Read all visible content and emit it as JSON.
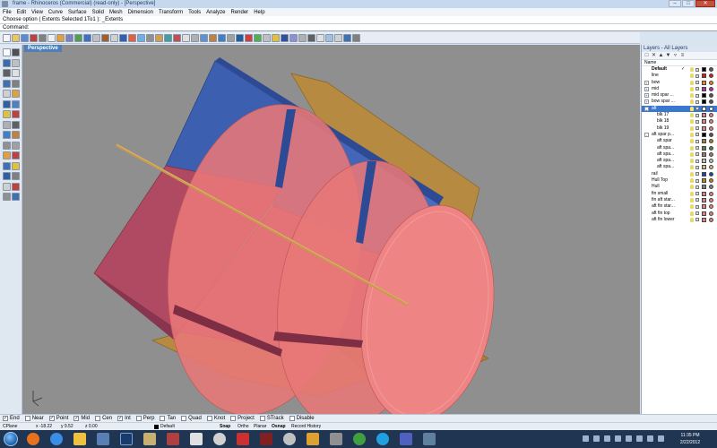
{
  "window": {
    "title": "frame - Rhinoceros (Commercial) (read-only) - [Perspective]"
  },
  "menu": [
    "File",
    "Edit",
    "View",
    "Curve",
    "Surface",
    "Solid",
    "Mesh",
    "Dimension",
    "Transform",
    "Tools",
    "Analyze",
    "Render",
    "Help"
  ],
  "command": {
    "history": "Choose option ( Extents  Selected  1To1 ): _Extents",
    "prompt": "Command:"
  },
  "viewport": {
    "name": "Perspective"
  },
  "layers_panel": {
    "title": "Layers - All Layers",
    "header": "Name",
    "layers": [
      {
        "name": "Default",
        "check": "✓",
        "indent": 0,
        "expand": "",
        "color": "#000000",
        "bold": true
      },
      {
        "name": "line",
        "indent": 0,
        "expand": "",
        "color": "#cc2222"
      },
      {
        "name": "bow",
        "indent": 0,
        "expand": "+",
        "color": "#e08a1e"
      },
      {
        "name": "mid",
        "indent": 0,
        "expand": "+",
        "color": "#b030b0"
      },
      {
        "name": "mid spar ...",
        "indent": 0,
        "expand": "+",
        "color": "#000000"
      },
      {
        "name": "bow spar ...",
        "indent": 0,
        "expand": "+",
        "color": "#000000"
      },
      {
        "name": "aft",
        "indent": 0,
        "expand": "-",
        "color": "#ffffff",
        "selected": true
      },
      {
        "name": "blk 17",
        "indent": 1,
        "expand": "",
        "color": "#e08080"
      },
      {
        "name": "blk 18",
        "indent": 1,
        "expand": "",
        "color": "#e08080"
      },
      {
        "name": "blk 19",
        "indent": 1,
        "expand": "",
        "color": "#e08080"
      },
      {
        "name": "aft spar p...",
        "indent": 0,
        "expand": "-",
        "color": "#000000"
      },
      {
        "name": "aft spar",
        "indent": 1,
        "expand": "",
        "color": "#a08040"
      },
      {
        "name": "aft spa...",
        "indent": 1,
        "expand": "",
        "color": "#5a7a50"
      },
      {
        "name": "aft spa...",
        "indent": 1,
        "expand": "",
        "color": "#9a7b6a"
      },
      {
        "name": "aft spa...",
        "indent": 1,
        "expand": "",
        "color": "#c0c0c0"
      },
      {
        "name": "aft spa...",
        "indent": 1,
        "expand": "",
        "color": "#d2b48c"
      },
      {
        "name": "rail",
        "indent": 0,
        "expand": "",
        "color": "#2244aa"
      },
      {
        "name": "Hull Top",
        "indent": 0,
        "expand": "",
        "color": "#b8860b"
      },
      {
        "name": "Hull",
        "indent": 0,
        "expand": "",
        "color": "#808080"
      },
      {
        "name": "fin small",
        "indent": 0,
        "expand": "",
        "color": "#e08080"
      },
      {
        "name": "fin aft star...",
        "indent": 0,
        "expand": "",
        "color": "#e08080"
      },
      {
        "name": "aft fin star...",
        "indent": 0,
        "expand": "",
        "color": "#e08080"
      },
      {
        "name": "aft fin top",
        "indent": 0,
        "expand": "",
        "color": "#e08080"
      },
      {
        "name": "aft fin lower",
        "indent": 0,
        "expand": "",
        "color": "#e08080"
      }
    ]
  },
  "osnaps": [
    {
      "label": "End",
      "checked": true
    },
    {
      "label": "Near",
      "checked": false
    },
    {
      "label": "Point",
      "checked": true
    },
    {
      "label": "Mid",
      "checked": true
    },
    {
      "label": "Cen",
      "checked": false
    },
    {
      "label": "Int",
      "checked": true
    },
    {
      "label": "Perp",
      "checked": false
    },
    {
      "label": "Tan",
      "checked": false
    },
    {
      "label": "Quad",
      "checked": false
    },
    {
      "label": "Knot",
      "checked": false
    },
    {
      "label": "Project",
      "checked": false
    },
    {
      "label": "STrack",
      "checked": false
    },
    {
      "label": "Disable",
      "checked": false
    }
  ],
  "status": {
    "cplane": "CPlane",
    "x": "x -18.22",
    "y": "y 9.52",
    "z": "z 0.00",
    "layer": "Default",
    "snap": "Snap",
    "ortho": "Ortho",
    "planar": "Planar",
    "osnap": "Osnap",
    "record_history": "Record History"
  },
  "taskbar": {
    "time": "11:35 PM",
    "date": "2/22/2012"
  },
  "colors": {
    "blue_plate": "#3d5fb0",
    "pink_bulkhead": "#e87878",
    "maroon_plate": "#b04a62",
    "gold_hull": "#b68a40"
  }
}
